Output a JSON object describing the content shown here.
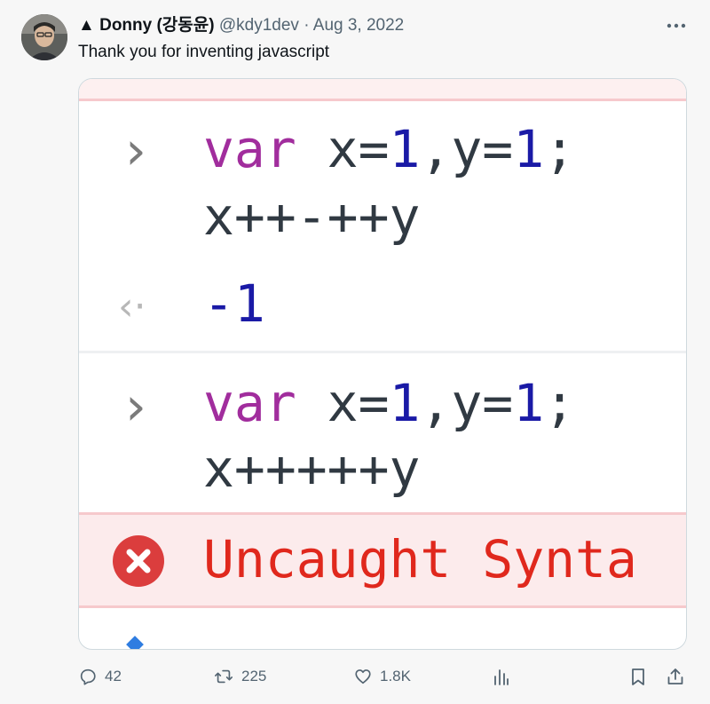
{
  "tweet": {
    "verified_glyph": "▲",
    "author_name": "Donny (강동윤)",
    "handle": "@kdy1dev",
    "dot": "·",
    "date": "Aug 3, 2022",
    "text": "Thank you for inventing javascript",
    "more_icon": "more-horizontal-icon"
  },
  "media": {
    "console": {
      "entry1": {
        "prompt": "›",
        "line1_keyword": "var",
        "line1_a": " x=",
        "line1_num1": "1",
        "line1_b": ",y=",
        "line1_num2": "1",
        "line1_c": ";",
        "line2": "x++-++y"
      },
      "result1": {
        "prompt": "‹·",
        "value": "-1"
      },
      "entry2": {
        "prompt": "›",
        "line1_keyword": "var",
        "line1_a": " x=",
        "line1_num1": "1",
        "line1_b": ",y=",
        "line1_num2": "1",
        "line1_c": ";",
        "line2": "x+++++y"
      },
      "error": {
        "icon": "error-x-icon",
        "text": "Uncaught Synta"
      }
    }
  },
  "actions": {
    "reply": {
      "icon": "reply-icon",
      "count": "42"
    },
    "retweet": {
      "icon": "retweet-icon",
      "count": "225"
    },
    "like": {
      "icon": "heart-icon",
      "count": "1.8K"
    },
    "views": {
      "icon": "analytics-icon"
    },
    "bookmark": {
      "icon": "bookmark-icon"
    },
    "share": {
      "icon": "share-icon"
    }
  },
  "colors": {
    "keyword": "#a12d9d",
    "number": "#1a1aa6",
    "error": "#e0281d",
    "muted": "#536471"
  }
}
